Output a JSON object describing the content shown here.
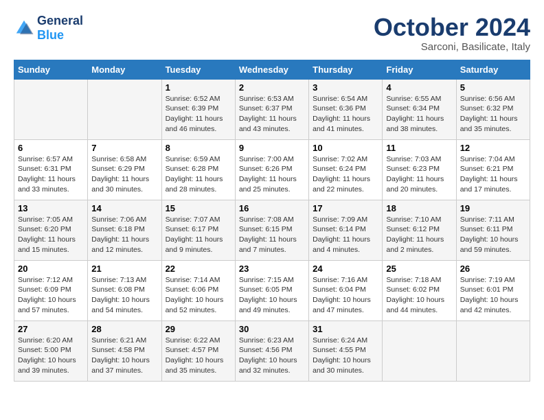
{
  "header": {
    "logo_line1": "General",
    "logo_line2": "Blue",
    "month": "October 2024",
    "location": "Sarconi, Basilicate, Italy"
  },
  "days_of_week": [
    "Sunday",
    "Monday",
    "Tuesday",
    "Wednesday",
    "Thursday",
    "Friday",
    "Saturday"
  ],
  "weeks": [
    [
      {
        "num": "",
        "info": ""
      },
      {
        "num": "",
        "info": ""
      },
      {
        "num": "1",
        "info": "Sunrise: 6:52 AM\nSunset: 6:39 PM\nDaylight: 11 hours and 46 minutes."
      },
      {
        "num": "2",
        "info": "Sunrise: 6:53 AM\nSunset: 6:37 PM\nDaylight: 11 hours and 43 minutes."
      },
      {
        "num": "3",
        "info": "Sunrise: 6:54 AM\nSunset: 6:36 PM\nDaylight: 11 hours and 41 minutes."
      },
      {
        "num": "4",
        "info": "Sunrise: 6:55 AM\nSunset: 6:34 PM\nDaylight: 11 hours and 38 minutes."
      },
      {
        "num": "5",
        "info": "Sunrise: 6:56 AM\nSunset: 6:32 PM\nDaylight: 11 hours and 35 minutes."
      }
    ],
    [
      {
        "num": "6",
        "info": "Sunrise: 6:57 AM\nSunset: 6:31 PM\nDaylight: 11 hours and 33 minutes."
      },
      {
        "num": "7",
        "info": "Sunrise: 6:58 AM\nSunset: 6:29 PM\nDaylight: 11 hours and 30 minutes."
      },
      {
        "num": "8",
        "info": "Sunrise: 6:59 AM\nSunset: 6:28 PM\nDaylight: 11 hours and 28 minutes."
      },
      {
        "num": "9",
        "info": "Sunrise: 7:00 AM\nSunset: 6:26 PM\nDaylight: 11 hours and 25 minutes."
      },
      {
        "num": "10",
        "info": "Sunrise: 7:02 AM\nSunset: 6:24 PM\nDaylight: 11 hours and 22 minutes."
      },
      {
        "num": "11",
        "info": "Sunrise: 7:03 AM\nSunset: 6:23 PM\nDaylight: 11 hours and 20 minutes."
      },
      {
        "num": "12",
        "info": "Sunrise: 7:04 AM\nSunset: 6:21 PM\nDaylight: 11 hours and 17 minutes."
      }
    ],
    [
      {
        "num": "13",
        "info": "Sunrise: 7:05 AM\nSunset: 6:20 PM\nDaylight: 11 hours and 15 minutes."
      },
      {
        "num": "14",
        "info": "Sunrise: 7:06 AM\nSunset: 6:18 PM\nDaylight: 11 hours and 12 minutes."
      },
      {
        "num": "15",
        "info": "Sunrise: 7:07 AM\nSunset: 6:17 PM\nDaylight: 11 hours and 9 minutes."
      },
      {
        "num": "16",
        "info": "Sunrise: 7:08 AM\nSunset: 6:15 PM\nDaylight: 11 hours and 7 minutes."
      },
      {
        "num": "17",
        "info": "Sunrise: 7:09 AM\nSunset: 6:14 PM\nDaylight: 11 hours and 4 minutes."
      },
      {
        "num": "18",
        "info": "Sunrise: 7:10 AM\nSunset: 6:12 PM\nDaylight: 11 hours and 2 minutes."
      },
      {
        "num": "19",
        "info": "Sunrise: 7:11 AM\nSunset: 6:11 PM\nDaylight: 10 hours and 59 minutes."
      }
    ],
    [
      {
        "num": "20",
        "info": "Sunrise: 7:12 AM\nSunset: 6:09 PM\nDaylight: 10 hours and 57 minutes."
      },
      {
        "num": "21",
        "info": "Sunrise: 7:13 AM\nSunset: 6:08 PM\nDaylight: 10 hours and 54 minutes."
      },
      {
        "num": "22",
        "info": "Sunrise: 7:14 AM\nSunset: 6:06 PM\nDaylight: 10 hours and 52 minutes."
      },
      {
        "num": "23",
        "info": "Sunrise: 7:15 AM\nSunset: 6:05 PM\nDaylight: 10 hours and 49 minutes."
      },
      {
        "num": "24",
        "info": "Sunrise: 7:16 AM\nSunset: 6:04 PM\nDaylight: 10 hours and 47 minutes."
      },
      {
        "num": "25",
        "info": "Sunrise: 7:18 AM\nSunset: 6:02 PM\nDaylight: 10 hours and 44 minutes."
      },
      {
        "num": "26",
        "info": "Sunrise: 7:19 AM\nSunset: 6:01 PM\nDaylight: 10 hours and 42 minutes."
      }
    ],
    [
      {
        "num": "27",
        "info": "Sunrise: 6:20 AM\nSunset: 5:00 PM\nDaylight: 10 hours and 39 minutes."
      },
      {
        "num": "28",
        "info": "Sunrise: 6:21 AM\nSunset: 4:58 PM\nDaylight: 10 hours and 37 minutes."
      },
      {
        "num": "29",
        "info": "Sunrise: 6:22 AM\nSunset: 4:57 PM\nDaylight: 10 hours and 35 minutes."
      },
      {
        "num": "30",
        "info": "Sunrise: 6:23 AM\nSunset: 4:56 PM\nDaylight: 10 hours and 32 minutes."
      },
      {
        "num": "31",
        "info": "Sunrise: 6:24 AM\nSunset: 4:55 PM\nDaylight: 10 hours and 30 minutes."
      },
      {
        "num": "",
        "info": ""
      },
      {
        "num": "",
        "info": ""
      }
    ]
  ]
}
